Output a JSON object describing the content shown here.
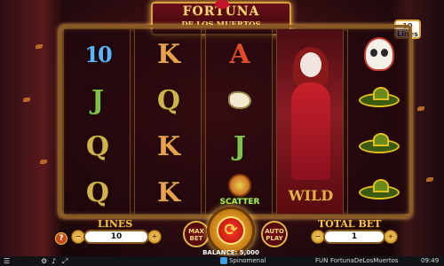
{
  "game": {
    "title_line1": "FORTUNA",
    "title_line2": "DE LOS MUERTOS",
    "lines_badge_number": "10",
    "lines_badge_text": "Lines"
  },
  "reels": [
    {
      "symbols": [
        "10",
        "J",
        "Q",
        "Q"
      ]
    },
    {
      "symbols": [
        "K",
        "Q",
        "K",
        "K"
      ]
    },
    {
      "symbols": [
        "A",
        "flower",
        "J",
        "maracas"
      ],
      "scatter_label": "SCATTER"
    },
    {
      "symbols": [
        "wild-lady"
      ],
      "wild_label": "WILD"
    },
    {
      "symbols": [
        "skull",
        "hat",
        "hat",
        "hat"
      ]
    }
  ],
  "controls": {
    "help_label": "?",
    "lines_label": "LINES",
    "lines_value": "10",
    "total_bet_label": "TOTAL BET",
    "total_bet_value": "1",
    "max_bet_label": "MAX BET",
    "auto_play_label": "AUTO PLAY",
    "balance_text": "BALANCE: 5,000",
    "decrease_symbol": "−",
    "increase_symbol": "+"
  },
  "status_bar": {
    "brand": "Spinomenal",
    "mode": "FUN",
    "game_id": "FortunaDeLosMuertos",
    "time": "09:49"
  },
  "colors": {
    "accent_gold": "#e2b24a",
    "spin_red": "#d81e14",
    "background": "#3a0f14"
  }
}
